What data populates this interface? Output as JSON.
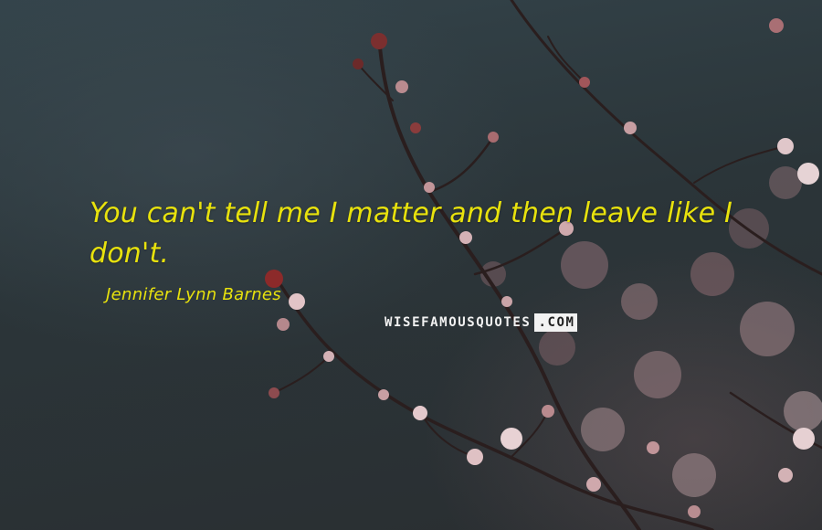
{
  "quote": {
    "text": "You can't tell me I matter and then leave like I don't."
  },
  "author": {
    "name": "Jennifer Lynn Barnes"
  },
  "watermark": {
    "main": "WISEFAMOUSQUOTES",
    "suffix": ".COM"
  },
  "colors": {
    "quote_text": "#e8e20d",
    "background": "#2f3a3f",
    "blossom": "#d9b7bd"
  }
}
